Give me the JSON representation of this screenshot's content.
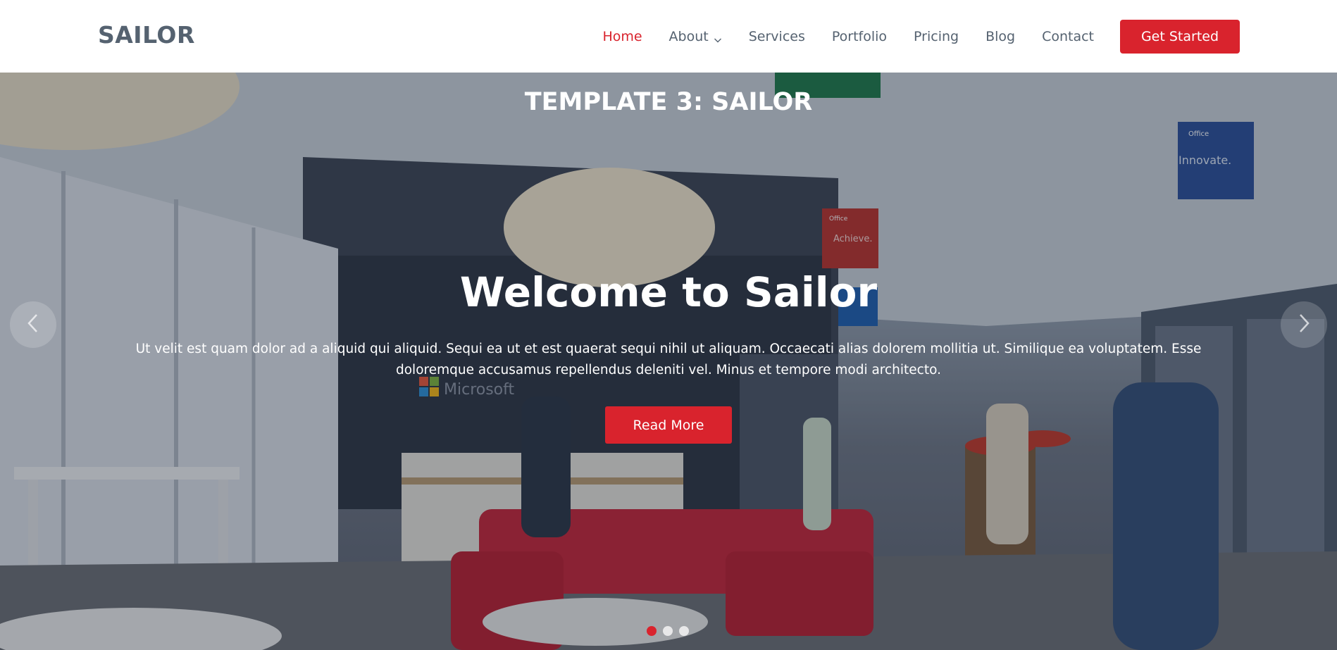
{
  "header": {
    "logo": "SAILOR",
    "nav": [
      {
        "label": "Home",
        "active": true
      },
      {
        "label": "About",
        "has_dropdown": true
      },
      {
        "label": "Services"
      },
      {
        "label": "Portfolio"
      },
      {
        "label": "Pricing"
      },
      {
        "label": "Blog"
      },
      {
        "label": "Contact"
      }
    ],
    "cta_label": "Get Started"
  },
  "hero": {
    "template_title": "TEMPLATE 3: SAILOR",
    "title": "Welcome to Sailor",
    "text": "Ut velit est quam dolor ad a aliquid qui aliquid. Sequi ea ut et est quaerat sequi nihil ut aliquam. Occaecati alias dolorem mollitia ut. Similique ea voluptatem. Esse doloremque accusamus repellendus deleniti vel. Minus et tempore modi architecto.",
    "button_label": "Read More",
    "background_text": {
      "company_logo": "Microsoft",
      "sign_1_brand": "Office",
      "sign_1_text": "Achieve.",
      "sign_2_brand": "Office",
      "sign_2_text": "Innovate."
    },
    "slides_count": 3,
    "active_slide": 1
  },
  "colors": {
    "accent": "#d9232d",
    "nav_text": "#556270",
    "header_bg": "#ffffff"
  },
  "icons": {
    "prev": "chevron-left-icon",
    "next": "chevron-right-icon",
    "dropdown": "chevron-down-icon"
  }
}
